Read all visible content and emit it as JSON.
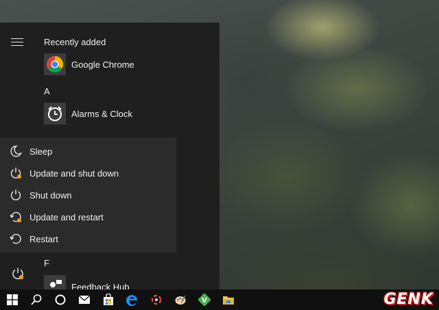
{
  "start_menu": {
    "section_recently_added": "Recently added",
    "letter_a": "A",
    "letter_f": "F",
    "apps": {
      "chrome": {
        "label": "Google Chrome",
        "icon": "chrome-icon"
      },
      "alarms": {
        "label": "Alarms & Clock",
        "icon": "alarm-clock-icon"
      },
      "feedback": {
        "label": "Feedback Hub",
        "icon": "feedback-hub-icon"
      }
    }
  },
  "power_menu": {
    "items": [
      {
        "label": "Sleep",
        "icon": "moon-icon"
      },
      {
        "label": "Update and shut down",
        "icon": "power-update-icon"
      },
      {
        "label": "Shut down",
        "icon": "power-icon"
      },
      {
        "label": "Update and restart",
        "icon": "restart-update-icon"
      },
      {
        "label": "Restart",
        "icon": "restart-icon"
      }
    ]
  },
  "taskbar": {
    "buttons": [
      "windows-start-icon",
      "search-icon",
      "cortana-icon",
      "mail-icon",
      "store-icon",
      "edge-icon",
      "app-icon",
      "paint-icon",
      "vim-icon",
      "file-explorer-icon"
    ]
  },
  "watermark": "GENK",
  "colors": {
    "menu_bg": "#1f1f1f",
    "power_menu_bg": "#2b2b2b",
    "taskbar_bg": "#101010",
    "update_dot": "#f0a020"
  }
}
